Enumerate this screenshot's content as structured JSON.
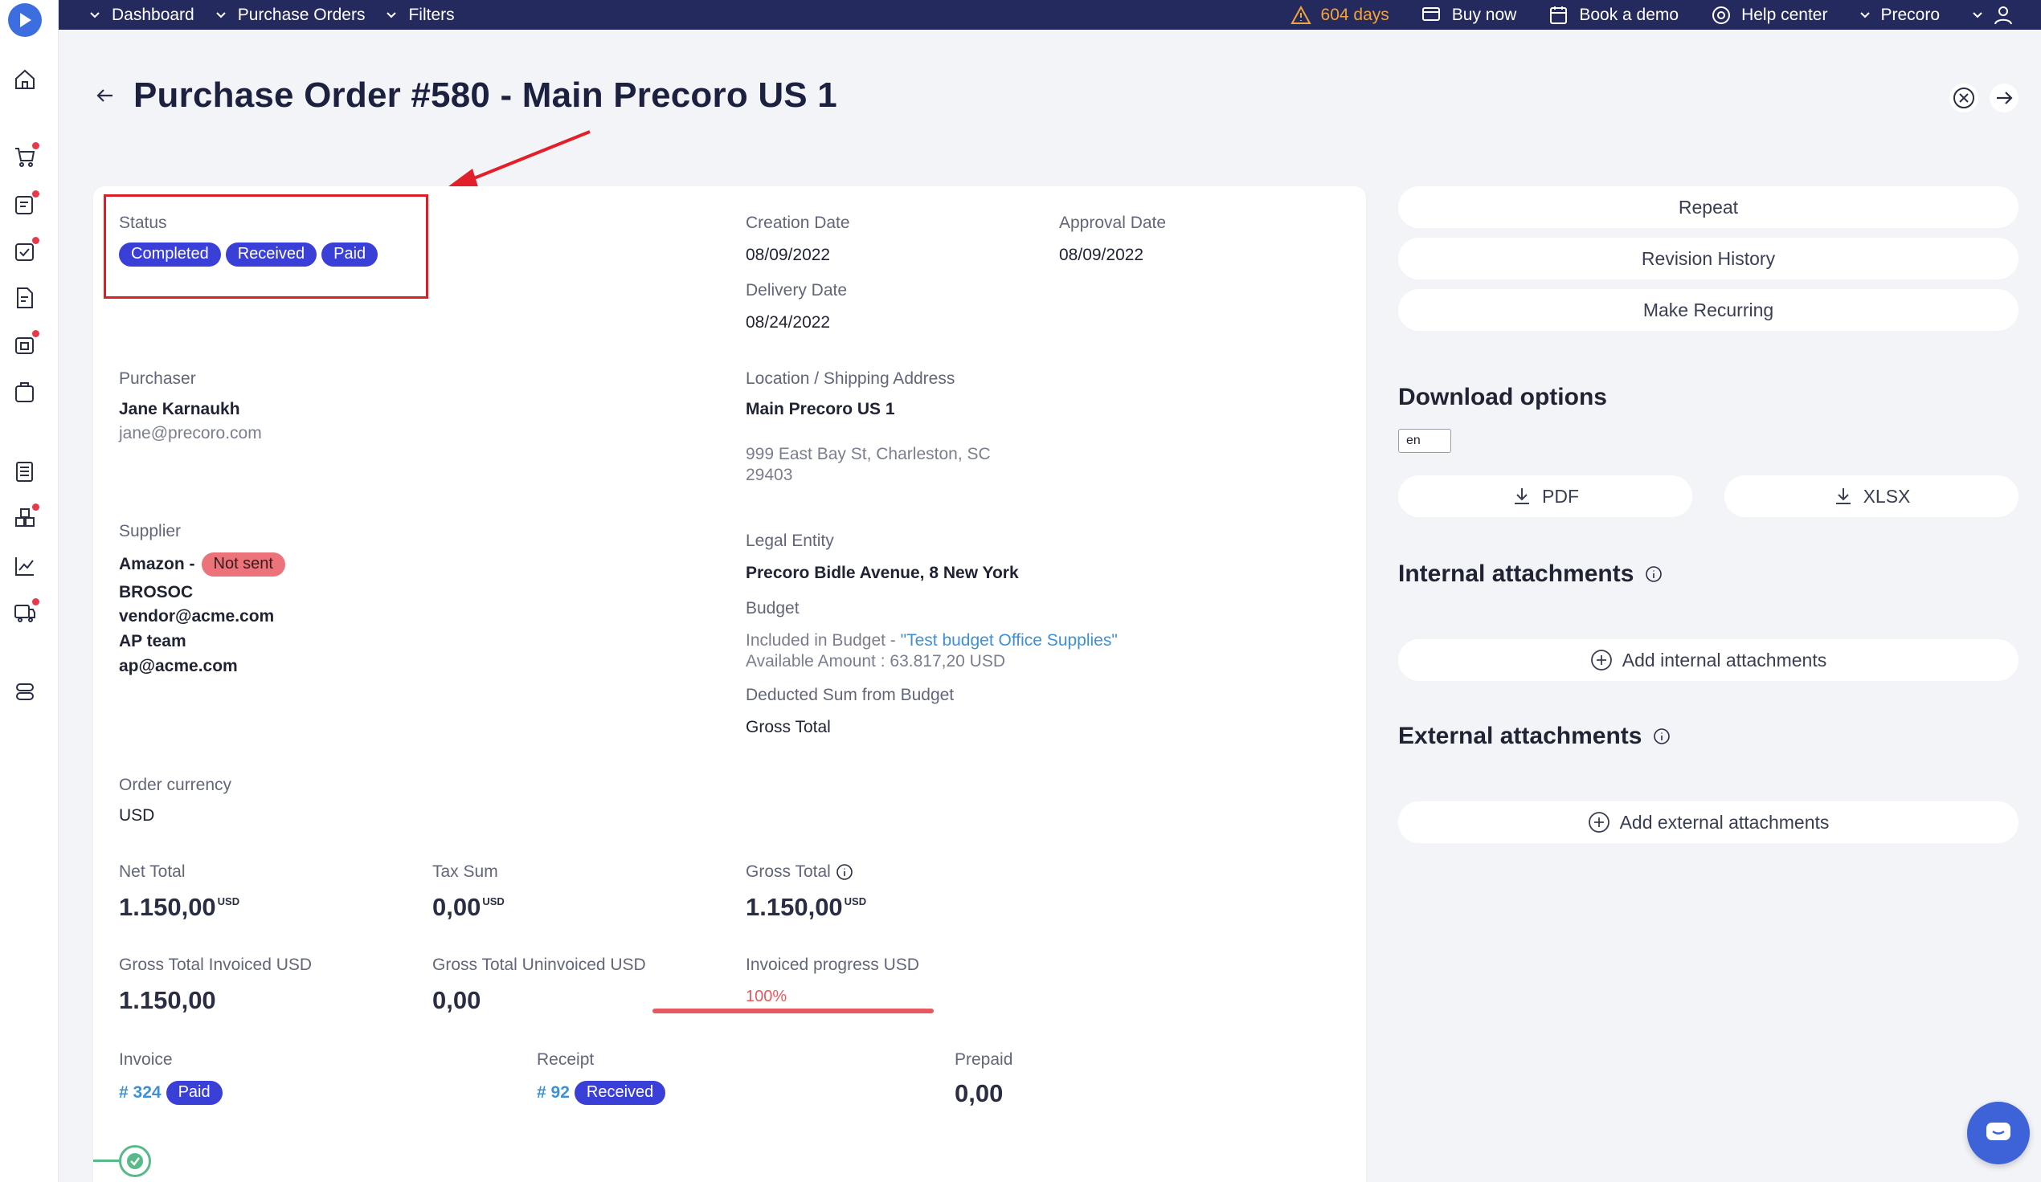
{
  "nav": {
    "items": [
      "Dashboard",
      "Purchase Orders",
      "Filters"
    ],
    "trial_days": "604 days",
    "buy_now": "Buy now",
    "book_demo": "Book a demo",
    "help_center": "Help center",
    "company": "Precoro"
  },
  "header": {
    "title": "Purchase Order #580 - Main Precoro US 1"
  },
  "status": {
    "label": "Status",
    "badges": [
      "Completed",
      "Received",
      "Paid"
    ]
  },
  "dates": {
    "creation_label": "Creation Date",
    "creation_value": "08/09/2022",
    "approval_label": "Approval Date",
    "approval_value": "08/09/2022",
    "delivery_label": "Delivery Date",
    "delivery_value": "08/24/2022"
  },
  "purchaser": {
    "label": "Purchaser",
    "name": "Jane Karnaukh",
    "email": "jane@precoro.com"
  },
  "location": {
    "label": "Location / Shipping Address",
    "name": "Main Precoro US 1",
    "address_line1": "999 East Bay St, Charleston, SC",
    "address_line2": "29403"
  },
  "supplier": {
    "label": "Supplier",
    "name": "Amazon -",
    "badge": "Not sent",
    "lines": [
      "BROSOC",
      "vendor@acme.com",
      "AP team",
      "ap@acme.com"
    ]
  },
  "legal": {
    "label": "Legal Entity",
    "value": "Precoro Bidle Avenue, 8 New York"
  },
  "budget": {
    "label": "Budget",
    "included_prefix": "Included in Budget - ",
    "budget_name": "\"Test budget Office Supplies\"",
    "available": "Available Amount : 63.817,20 USD",
    "deducted_label": "Deducted Sum from Budget",
    "deducted_value": "Gross Total"
  },
  "currency": {
    "label": "Order currency",
    "value": "USD"
  },
  "totals": {
    "net_label": "Net Total",
    "net_value": "1.150,00",
    "net_unit": "USD",
    "tax_label": "Tax Sum",
    "tax_value": "0,00",
    "tax_unit": "USD",
    "gross_label": "Gross Total",
    "gross_value": "1.150,00",
    "gross_unit": "USD",
    "invoiced_label": "Gross Total Invoiced USD",
    "invoiced_value": "1.150,00",
    "uninvoiced_label": "Gross Total Uninvoiced USD",
    "uninvoiced_value": "0,00",
    "progress_label": "Invoiced progress USD",
    "progress_text": "100%",
    "progress_fraction": 1.0
  },
  "documents": {
    "invoice_label": "Invoice",
    "invoice_no": "# 324",
    "invoice_badge": "Paid",
    "receipt_label": "Receipt",
    "receipt_no": "# 92",
    "receipt_badge": "Received",
    "prepaid_label": "Prepaid",
    "prepaid_value": "0,00"
  },
  "side": {
    "repeat": "Repeat",
    "revision": "Revision History",
    "recurring": "Make Recurring",
    "download_title": "Download options",
    "lang": "en",
    "pdf": "PDF",
    "xlsx": "XLSX",
    "internal_title": "Internal attachments",
    "add_internal": "Add internal attachments",
    "external_title": "External attachments",
    "add_external": "Add external attachments"
  },
  "colors": {
    "nav_bg": "#252a5e",
    "badge": "#3a3fd8",
    "warn": "#f3a43b",
    "danger": "#e8585f",
    "link": "#3c91d6"
  }
}
